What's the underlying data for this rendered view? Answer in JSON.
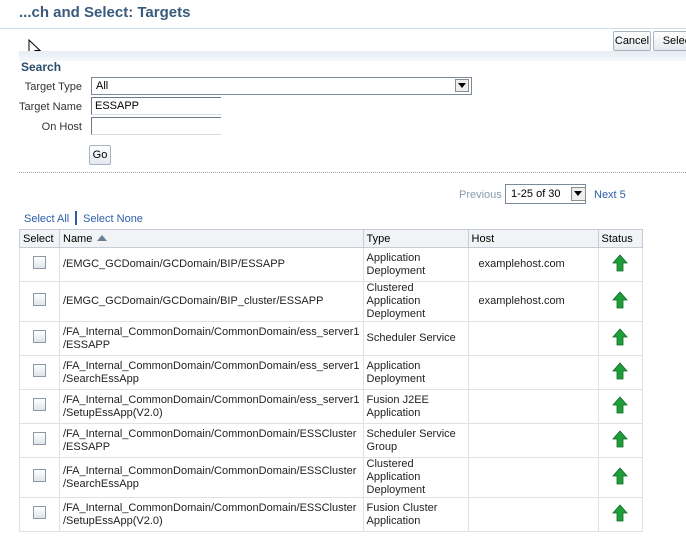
{
  "header": {
    "title": "...ch and Select: Targets"
  },
  "toolbar": {
    "cancel_label": "Cancel",
    "select_label": "Select"
  },
  "search": {
    "heading": "Search",
    "target_type_label": "Target Type",
    "target_type_value": "All",
    "target_name_label": "Target Name",
    "target_name_value": "ESSAPP",
    "on_host_label": "On Host",
    "on_host_value": "",
    "go_label": "Go"
  },
  "pager": {
    "previous_label": "Previous",
    "range_value": "1-25 of 30",
    "next_label": "Next 5"
  },
  "selection": {
    "select_all": "Select All",
    "select_none": "Select None"
  },
  "table": {
    "headers": {
      "select": "Select",
      "name": "Name",
      "type": "Type",
      "host": "Host",
      "status": "Status"
    },
    "rows": [
      {
        "name": "/EMGC_GCDomain/GCDomain/BIP/ESSAPP",
        "type": "Application Deployment",
        "host": "examplehost.com"
      },
      {
        "name": "/EMGC_GCDomain/GCDomain/BIP_cluster/ESSAPP",
        "type": "Clustered Application Deployment",
        "host": "examplehost.com"
      },
      {
        "name": "/FA_Internal_CommonDomain/CommonDomain/ess_server1 /ESSAPP",
        "type": "Scheduler Service",
        "host": ""
      },
      {
        "name": "/FA_Internal_CommonDomain/CommonDomain/ess_server1 /SearchEssApp",
        "type": "Application Deployment",
        "host": ""
      },
      {
        "name": "/FA_Internal_CommonDomain/CommonDomain/ess_server1 /SetupEssApp(V2.0)",
        "type": "Fusion J2EE Application",
        "host": ""
      },
      {
        "name": "/FA_Internal_CommonDomain/CommonDomain/ESSCluster /ESSAPP",
        "type": "Scheduler Service Group",
        "host": ""
      },
      {
        "name": "/FA_Internal_CommonDomain/CommonDomain/ESSCluster /SearchEssApp",
        "type": "Clustered Application Deployment",
        "host": ""
      },
      {
        "name": "/FA_Internal_CommonDomain/CommonDomain/ESSCluster /SetupEssApp(V2.0)",
        "type": "Fusion Cluster Application",
        "host": ""
      }
    ]
  },
  "colors": {
    "title": "#3a5a7c",
    "link": "#2d5fa8",
    "status_up": "#1e9e3a"
  },
  "icons": {
    "cursor": "mouse-pointer-icon",
    "status": "status-up-arrow-icon",
    "sort": "sort-ascending-icon",
    "dropdown": "chevron-down-icon"
  }
}
